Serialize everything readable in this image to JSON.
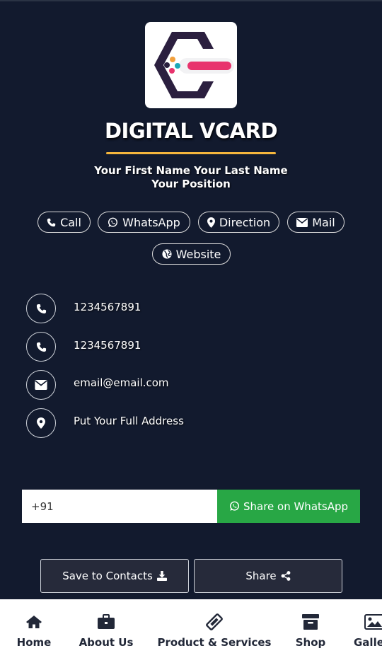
{
  "header": {
    "title": "DIGITAL VCARD"
  },
  "profile": {
    "name": "Your First Name Your Last Name",
    "position": "Your Position"
  },
  "actions": {
    "call": "Call",
    "whatsapp": "WhatsApp",
    "direction": "Direction",
    "mail": "Mail",
    "website": "Website"
  },
  "contacts": {
    "phone1": "1234567891",
    "phone2": "1234567891",
    "email": "email@email.com",
    "address": "Put Your Full Address"
  },
  "share_whatsapp": {
    "input_value": "+91",
    "button_label": "Share on WhatsApp"
  },
  "buttons": {
    "save_contacts": "Save to Contacts",
    "share": "Share"
  },
  "nav": {
    "home": "Home",
    "about": "About Us",
    "products": "Product & Services",
    "shop": "Shop",
    "gallery": "Galle"
  },
  "colors": {
    "background": "#121a2e",
    "accent_underline": "#f5b63d",
    "whatsapp_green": "#28a745",
    "logo_pink": "#e8336d"
  }
}
